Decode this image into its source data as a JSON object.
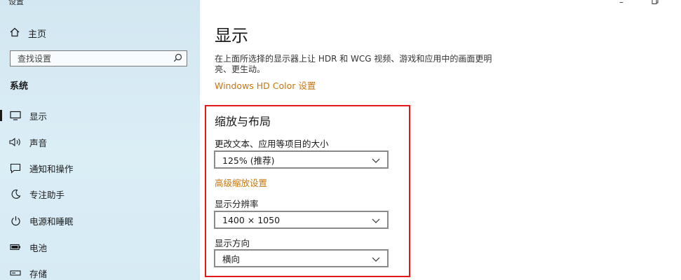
{
  "window": {
    "title": "设置"
  },
  "sidebar": {
    "home_label": "主页",
    "search_placeholder": "查找设置",
    "section_title": "系统",
    "items": [
      {
        "label": "显示",
        "icon": "monitor-icon",
        "active": true
      },
      {
        "label": "声音",
        "icon": "speaker-icon"
      },
      {
        "label": "通知和操作",
        "icon": "message-icon"
      },
      {
        "label": "专注助手",
        "icon": "moon-icon"
      },
      {
        "label": "电源和睡眠",
        "icon": "power-icon"
      },
      {
        "label": "电池",
        "icon": "battery-icon"
      },
      {
        "label": "存储",
        "icon": "storage-icon"
      }
    ]
  },
  "main": {
    "title": "显示",
    "description": "在上面所选择的显示器上让 HDR 和 WCG 视频、游戏和应用中的画面更明亮、更生动。",
    "hd_color_link": "Windows HD Color 设置",
    "layout_group": {
      "title": "缩放与布局",
      "scale_label": "更改文本、应用等项目的大小",
      "scale_value": "125% (推荐)",
      "advanced_link": "高级缩放设置",
      "resolution_label": "显示分辨率",
      "resolution_value": "1400 × 1050",
      "orientation_label": "显示方向",
      "orientation_value": "横向"
    }
  },
  "colors": {
    "link": "#c6760f",
    "highlight_box": "#e01919",
    "sidebar_bg": "#d7ebf5"
  }
}
